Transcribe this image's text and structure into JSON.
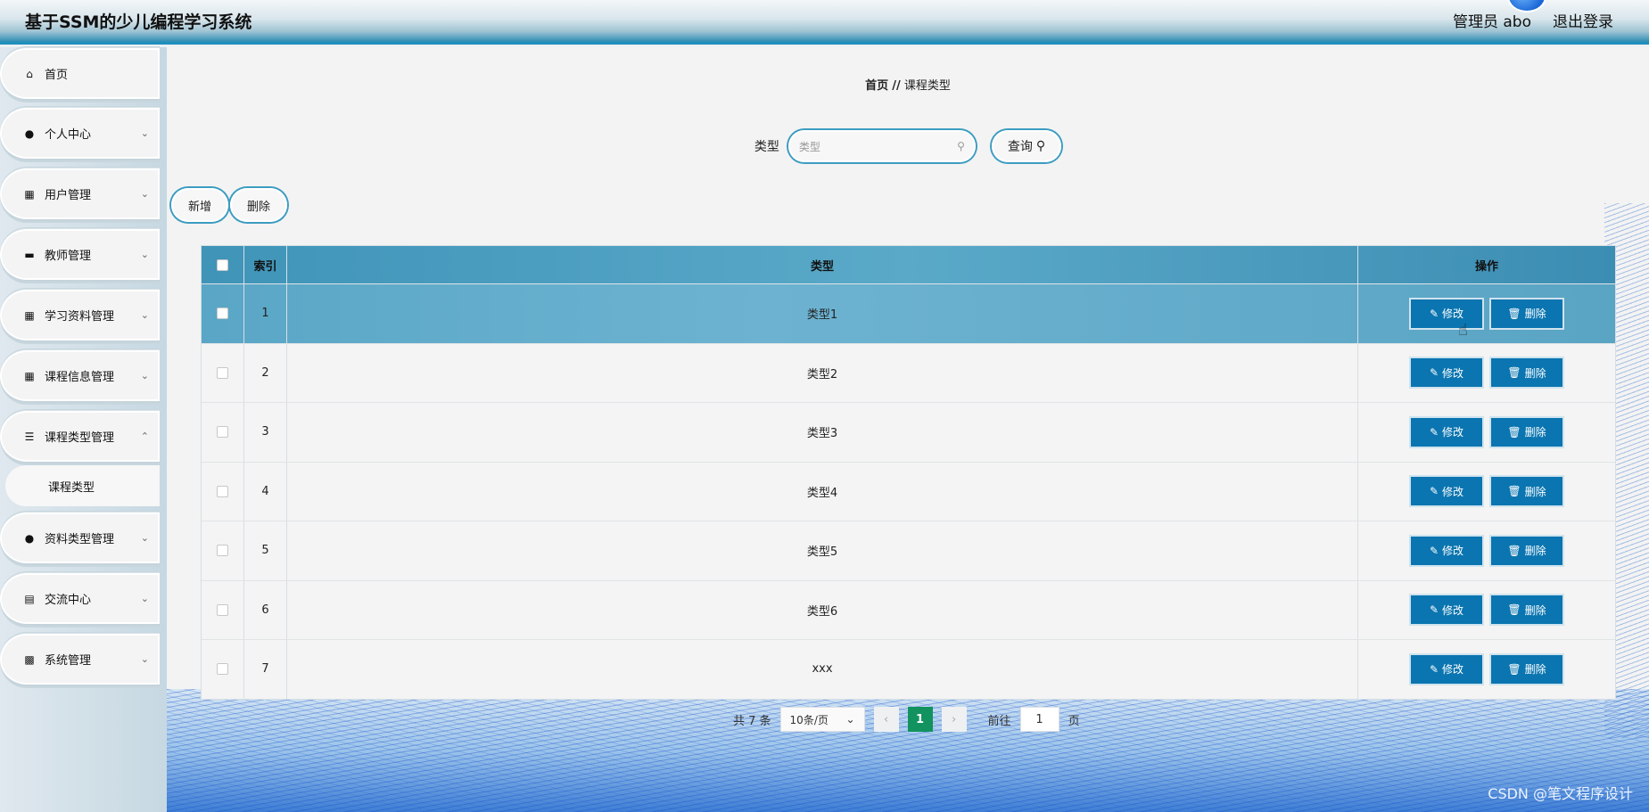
{
  "header": {
    "app_title": "基于SSM的少儿编程学习系统",
    "user_label": "管理员 abo",
    "logout_label": "退出登录"
  },
  "sidebar": {
    "items": [
      {
        "label": "首页",
        "icon": "home-icon"
      },
      {
        "label": "个人中心",
        "icon": "user-icon"
      },
      {
        "label": "用户管理",
        "icon": "grid-icon"
      },
      {
        "label": "教师管理",
        "icon": "teacher-icon"
      },
      {
        "label": "学习资料管理",
        "icon": "grid-icon"
      },
      {
        "label": "课程信息管理",
        "icon": "grid-icon"
      },
      {
        "label": "课程类型管理",
        "icon": "list-icon"
      },
      {
        "label": "资料类型管理",
        "icon": "pin-icon"
      },
      {
        "label": "交流中心",
        "icon": "chart-icon"
      },
      {
        "label": "系统管理",
        "icon": "bar-chart-icon"
      }
    ],
    "sub_item": "课程类型"
  },
  "breadcrumb": {
    "home": "首页",
    "sep": "//",
    "current": "课程类型"
  },
  "search": {
    "label": "类型",
    "placeholder": "类型",
    "query_button": "查询"
  },
  "actions": {
    "add": "新增",
    "delete": "删除"
  },
  "table": {
    "headers": {
      "index": "索引",
      "type": "类型",
      "operation": "操作"
    },
    "edit_label": "修改",
    "delete_label": "删除",
    "rows": [
      {
        "index": "1",
        "type": "类型1"
      },
      {
        "index": "2",
        "type": "类型2"
      },
      {
        "index": "3",
        "type": "类型3"
      },
      {
        "index": "4",
        "type": "类型4"
      },
      {
        "index": "5",
        "type": "类型5"
      },
      {
        "index": "6",
        "type": "类型6"
      },
      {
        "index": "7",
        "type": "xxx"
      }
    ]
  },
  "pagination": {
    "total": "共 7 条",
    "page_size": "10条/页",
    "current_page": "1",
    "goto_label": "前往",
    "goto_value": "1",
    "page_unit": "页"
  },
  "watermark": "CSDN @笔文程序设计",
  "colors": {
    "accent": "#3c9cc0",
    "button": "#0a75b0",
    "page_active": "#12925e"
  }
}
